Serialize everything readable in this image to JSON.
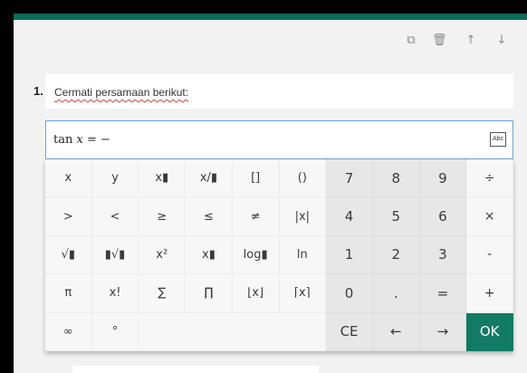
{
  "toolbar": {
    "copy_icon": "⧉",
    "delete_icon": "🗑",
    "up_icon": "↑",
    "down_icon": "↓"
  },
  "question": {
    "number": "1.",
    "text": "Cermati persamaan berikut:"
  },
  "equation": {
    "prefix": "tan ",
    "var": "x",
    "suffix": " = −",
    "abc_label": "Abc"
  },
  "keypad": {
    "keys": [
      "x",
      "y",
      "x▮",
      "x/▮",
      "[]",
      "()",
      "7",
      "8",
      "9",
      "÷",
      ">",
      "<",
      "≥",
      "≤",
      "≠",
      "|x|",
      "4",
      "5",
      "6",
      "×",
      "√▮",
      "▮√▮",
      "x²",
      "x▮",
      "log▮",
      "ln",
      "1",
      "2",
      "3",
      "-",
      "π",
      "x!",
      "∑",
      "∏",
      "⌊x⌋",
      "⌈x⌉",
      "0",
      ".",
      "=",
      "+",
      "∞",
      "°",
      "",
      "CE",
      "←",
      "→",
      "OK"
    ]
  },
  "colors": {
    "accent": "#137a64",
    "strip": "#0f6b5b",
    "focus_border": "#6aa3d6"
  }
}
